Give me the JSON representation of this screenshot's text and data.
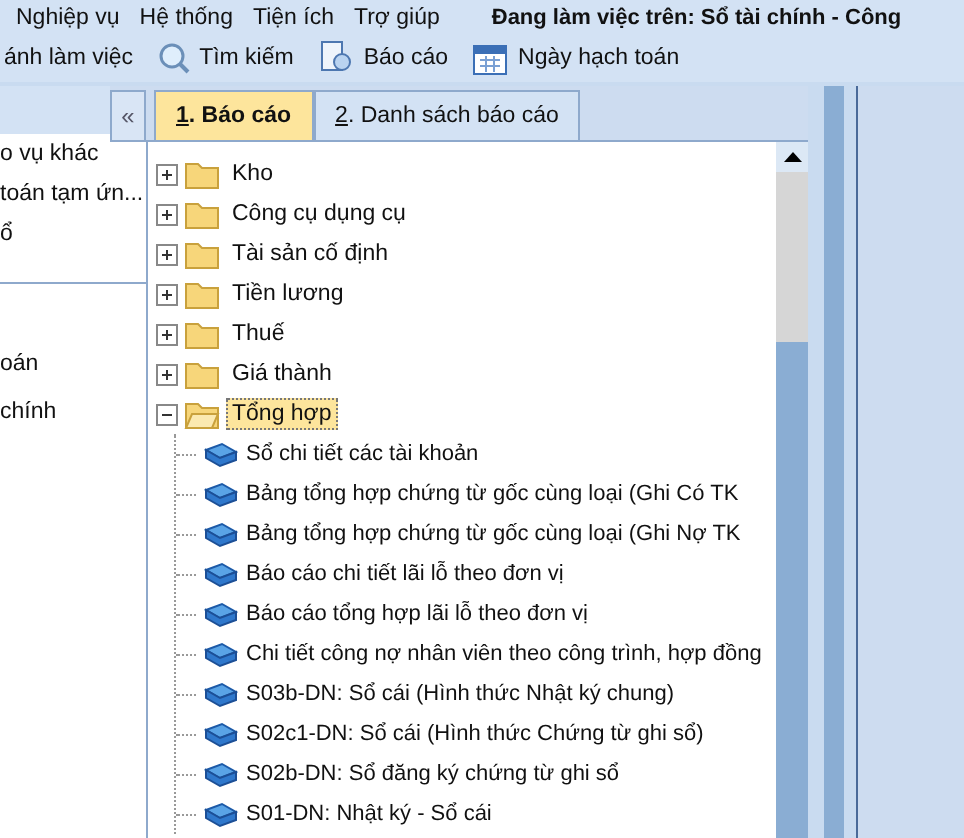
{
  "menu": [
    {
      "label": "Nghiệp vụ"
    },
    {
      "label": "Hệ thống"
    },
    {
      "label": "Tiện ích"
    },
    {
      "label": "Trợ giúp"
    }
  ],
  "working_on": "Đang làm việc trên: Sổ tài chính - Công",
  "toolbar": [
    {
      "kind": "text",
      "label": "ánh làm việc"
    },
    {
      "kind": "search",
      "label": "Tìm kiếm"
    },
    {
      "kind": "report",
      "label": "Báo cáo"
    },
    {
      "kind": "calendar",
      "label": "Ngày hạch toán"
    }
  ],
  "left_panel": {
    "items": [
      {
        "label": "o vụ khác"
      },
      {
        "label": "toán tạm ứn..."
      },
      {
        "label": "ổ"
      }
    ],
    "items_2": [
      {
        "label": "oán"
      },
      {
        "label": "chính"
      }
    ]
  },
  "collapse_button": "«",
  "tabs": [
    {
      "number": "1",
      "label": ". Báo cáo",
      "selected": true
    },
    {
      "number": "2",
      "label": ". Danh sách báo cáo",
      "selected": false
    }
  ],
  "tree": [
    {
      "label": "Kho",
      "expanded": false,
      "selected": false
    },
    {
      "label": "Công cụ dụng cụ",
      "expanded": false,
      "selected": false
    },
    {
      "label": "Tài sản cố định",
      "expanded": false,
      "selected": false
    },
    {
      "label": "Tiền lương",
      "expanded": false,
      "selected": false
    },
    {
      "label": "Thuế",
      "expanded": false,
      "selected": false
    },
    {
      "label": "Giá thành",
      "expanded": false,
      "selected": false
    },
    {
      "label": "Tổng hợp",
      "expanded": true,
      "selected": true,
      "children": [
        {
          "label": "Sổ chi tiết các tài khoản"
        },
        {
          "label": "Bảng tổng hợp chứng từ gốc cùng loại (Ghi Có TK"
        },
        {
          "label": "Bảng tổng hợp chứng từ gốc cùng loại (Ghi Nợ TK"
        },
        {
          "label": "Báo cáo chi tiết lãi lỗ theo đơn vị"
        },
        {
          "label": "Báo cáo tổng hợp lãi lỗ theo đơn vị"
        },
        {
          "label": "Chi tiết công nợ nhân viên theo công trình, hợp đồng"
        },
        {
          "label": "S03b-DN: Sổ cái (Hình thức Nhật ký chung)"
        },
        {
          "label": "S02c1-DN: Sổ cái (Hình thức Chứng từ ghi sổ)"
        },
        {
          "label": "S02b-DN: Sổ đăng ký chứng từ ghi sổ"
        },
        {
          "label": "S01-DN: Nhật ký - Sổ cái"
        }
      ]
    }
  ]
}
